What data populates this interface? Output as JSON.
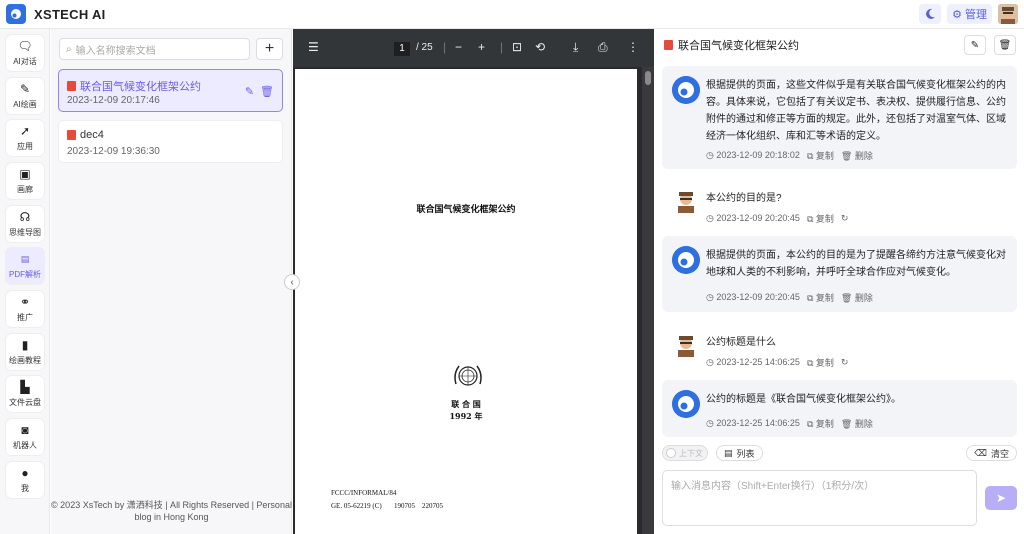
{
  "app": {
    "title": "XSTECH AI"
  },
  "topbar": {
    "manage_label": "管理"
  },
  "nav": {
    "items": [
      {
        "label": "AI对话",
        "icon": "chat-icon"
      },
      {
        "label": "AI绘画",
        "icon": "paint-icon"
      },
      {
        "label": "应用",
        "icon": "rocket-icon"
      },
      {
        "label": "画廊",
        "icon": "gallery-icon"
      },
      {
        "label": "思维导图",
        "icon": "mindmap-icon"
      },
      {
        "label": "PDF解析",
        "icon": "pdf-icon"
      },
      {
        "label": "推广",
        "icon": "handshake-icon"
      },
      {
        "label": "绘画教程",
        "icon": "book-icon"
      },
      {
        "label": "文件云盘",
        "icon": "file-icon"
      },
      {
        "label": "机器人",
        "icon": "robot-icon"
      },
      {
        "label": "我",
        "icon": "user-icon"
      }
    ]
  },
  "doclist": {
    "search_placeholder": "输入名称搜索文档",
    "docs": [
      {
        "name": "联合国气候变化框架公约",
        "time": "2023-12-09 20:17:46"
      },
      {
        "name": "dec4",
        "time": "2023-12-09 19:36:30"
      }
    ],
    "footer": "© 2023 XsTech by 潇洒科技 | All Rights Reserved | Personal blog in Hong Kong"
  },
  "viewer": {
    "page_current": "1",
    "page_total": "/ 25",
    "doc_title": "联合国气候变化框架公约",
    "un_name": "联 合 国",
    "year": "1992 年",
    "ref1": "FCCC/INFORMAL/84",
    "ref2": "GE. 05-62219 (C)       190705    220705"
  },
  "chat": {
    "title": "联合国气候变化框架公约",
    "messages": [
      {
        "role": "ai",
        "text": "根据提供的页面，这些文件似乎是有关联合国气候变化框架公约的内容。具体来说，它包括了有关议定书、表决权、提供履行信息、公约附件的通过和修正等方面的规定。此外，还包括了对温室气体、区域经济一体化组织、库和汇等术语的定义。",
        "time": "2023-12-09 20:18:02",
        "a1": "复制",
        "a2": "删除"
      },
      {
        "role": "user",
        "text": "本公约的目的是?",
        "time": "2023-12-09 20:20:45",
        "a1": "复制"
      },
      {
        "role": "ai",
        "text": "根据提供的页面，本公约的目的是为了提醒各缔约方注意气候变化对地球和人类的不利影响，并呼吁全球合作应对气候变化。",
        "time": "2023-12-09 20:20:45",
        "a1": "复制",
        "a2": "删除"
      },
      {
        "role": "user",
        "text": "公约标题是什么",
        "time": "2023-12-25 14:06:25",
        "a1": "复制"
      },
      {
        "role": "ai",
        "text": "公约的标题是《联合国气候变化框架公约》。",
        "time": "2023-12-25 14:06:25",
        "a1": "复制",
        "a2": "删除"
      }
    ],
    "context_label": "上下文",
    "list_label": "列表",
    "clear_label": "清空",
    "input_placeholder": "输入消息内容（Shift+Enter换行）（1积分/次）"
  }
}
